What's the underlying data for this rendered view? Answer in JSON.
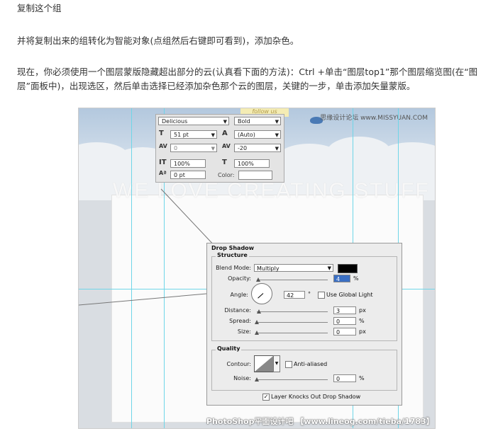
{
  "article": {
    "step_title": "复制这个组",
    "para2": "并将复制出来的组转化为智能对象(点组然后右键即可看到)，添加杂色。",
    "para3": "现在，你必须使用一个图层蒙版隐藏超出部分的云(认真看下面的方法)：Ctrl +单击“图层top1”那个图层缩览图(在“图层”面板中)，出现选区，然后单击选择已经添加杂色那个云的图层，关键的一步，单击添加矢量蒙版。"
  },
  "screenshot": {
    "big_text": "WE LOVE CREATING STUFF",
    "site_tag": "思缘设计论坛 www.MISSYUAN.COM",
    "banner_text": "follow us",
    "footer": "PhotoShop平面设计吧 【www.lineog.com/tieba/1783】",
    "character_panel": {
      "font_family": "Delicious",
      "font_style": "Bold",
      "font_size": "51 pt",
      "leading": "(Auto)",
      "kerning": "0",
      "tracking": "-20",
      "vertical_scale": "100%",
      "horizontal_scale": "100%",
      "baseline_shift": "0 pt",
      "color_label": "Color:"
    },
    "drop_shadow": {
      "title": "Drop Shadow",
      "structure_label": "Structure",
      "blend_mode_label": "Blend Mode:",
      "blend_mode_value": "Multiply",
      "shadow_color": "#000000",
      "opacity_label": "Opacity:",
      "opacity_value": "4",
      "opacity_unit": "%",
      "angle_label": "Angle:",
      "angle_value": "42",
      "angle_unit": "°",
      "use_global_light_label": "Use Global Light",
      "distance_label": "Distance:",
      "distance_value": "3",
      "distance_unit": "px",
      "spread_label": "Spread:",
      "spread_value": "0",
      "spread_unit": "%",
      "size_label": "Size:",
      "size_value": "0",
      "size_unit": "px",
      "quality_label": "Quality",
      "contour_label": "Contour:",
      "anti_aliased_label": "Anti-aliased",
      "noise_label": "Noise:",
      "noise_value": "0",
      "noise_unit": "%",
      "knockout_label": "Layer Knocks Out Drop Shadow",
      "knockout_checked": true
    }
  }
}
